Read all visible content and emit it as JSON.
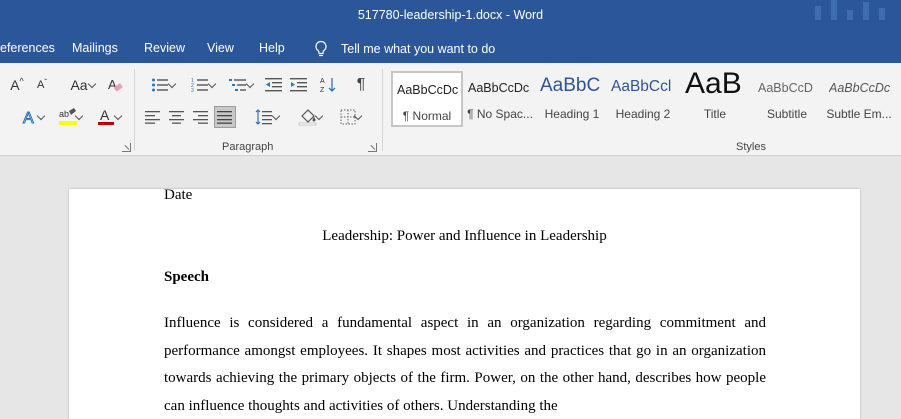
{
  "window": {
    "title": "517780-leadership-1.docx - Word"
  },
  "menu": {
    "items": [
      "eferences",
      "Mailings",
      "Review",
      "View",
      "Help"
    ],
    "tell_me": "Tell me what you want to do"
  },
  "ribbon": {
    "font_group": {
      "change_case": "Aa",
      "grow_font": "A",
      "shrink_font": "A"
    },
    "paragraph_group": {
      "label": "Paragraph"
    },
    "styles_group": {
      "label": "Styles",
      "items": [
        {
          "preview": "AaBbCcDc",
          "name": "¶ Normal"
        },
        {
          "preview": "AaBbCcDc",
          "name": "¶ No Spac..."
        },
        {
          "preview": "AaBbC",
          "name": "Heading 1"
        },
        {
          "preview": "AaBbCcl",
          "name": "Heading 2"
        },
        {
          "preview": "AaB",
          "name": "Title"
        },
        {
          "preview": "AaBbCcD",
          "name": "Subtitle"
        },
        {
          "preview": "AaBbCcDc",
          "name": "Subtle Em..."
        }
      ]
    }
  },
  "colors": {
    "accent": "#2b579a",
    "highlight": "#ffff00",
    "font_color": "#c00000"
  },
  "document": {
    "date": "Date",
    "title": "Leadership: Power and Influence in Leadership",
    "heading": "Speech",
    "body": "Influence is considered a fundamental aspect in an organization regarding commitment and performance amongst employees. It shapes most activities and practices that go in an organization towards achieving the primary objects of the firm. Power, on the other hand, describes how people can influence thoughts and activities of others. Understanding the"
  }
}
